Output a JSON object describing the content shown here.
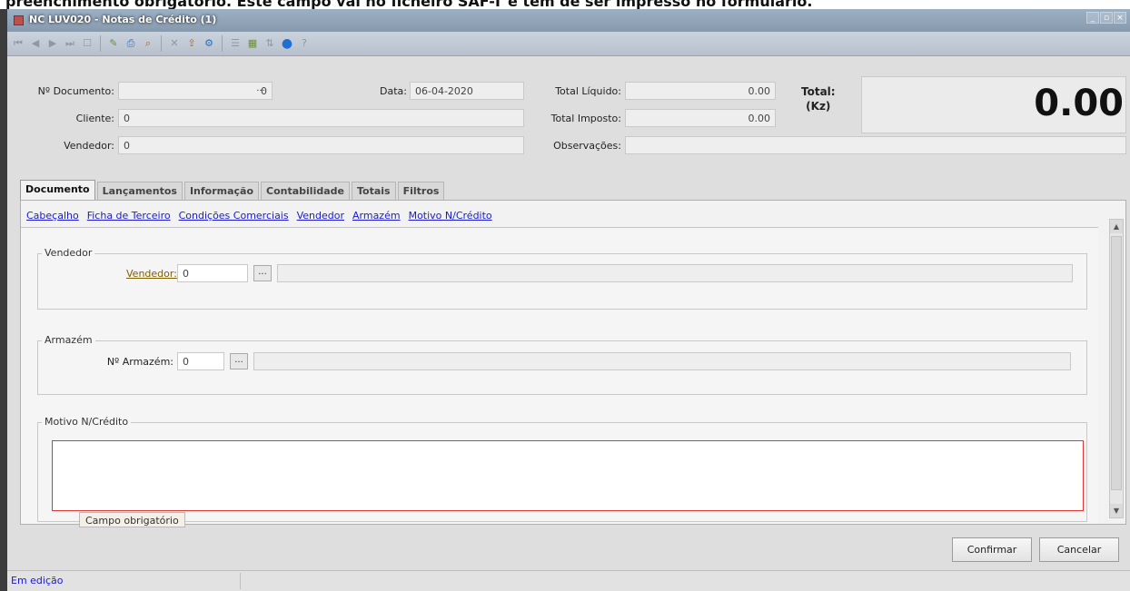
{
  "caption": "preenchimento obrigatório. Este campo vai no ficheiro SAF-T e tem de ser impresso no formulário.",
  "window": {
    "title": "NC LUV020 - Notas de Crédito (1)",
    "controls": [
      "_",
      "▫",
      "×"
    ]
  },
  "toolbar": {
    "icons": [
      "first-icon",
      "prev-icon",
      "next-icon",
      "last-icon",
      "new-icon",
      "edit-icon",
      "print-icon",
      "find-icon",
      "delete-icon",
      "export-icon",
      "tools-icon",
      "list-icon",
      "refresh-icon",
      "help-icon"
    ]
  },
  "header": {
    "documento_label": "Nº Documento:",
    "documento_value": "0",
    "documento_btn": "...",
    "data_label": "Data:",
    "data_value": "06-04-2020",
    "cliente_label": "Cliente:",
    "cliente_value": "0",
    "vendedor_label": "Vendedor:",
    "vendedor_value": "0",
    "total_liquido_label": "Total Líquido:",
    "total_liquido_value": "0.00",
    "total_imposto_label": "Total Imposto:",
    "total_imposto_value": "0.00",
    "observacoes_label": "Observações:",
    "observacoes_value": "",
    "total_label_line1": "Total:",
    "total_label_line2": "(Kz)",
    "total_value": "0.00"
  },
  "tabs": [
    {
      "label": "Documento",
      "active": true
    },
    {
      "label": "Lançamentos",
      "active": false
    },
    {
      "label": "Informação",
      "active": false
    },
    {
      "label": "Contabilidade",
      "active": false
    },
    {
      "label": "Totais",
      "active": false
    },
    {
      "label": "Filtros",
      "active": false
    }
  ],
  "section_links": [
    "Cabeçalho",
    "Ficha de Terceiro",
    "Condições Comerciais",
    "Vendedor",
    "Armazém",
    "Motivo N/Crédito"
  ],
  "vendedor_group": {
    "legend": "Vendedor",
    "label": "Vendedor:",
    "value": "0",
    "btn": "...",
    "description": ""
  },
  "armazem_group": {
    "legend": "Armazém",
    "label": "Nº Armazém:",
    "value": "0",
    "btn": "...",
    "description": ""
  },
  "motivo_group": {
    "legend": "Motivo N/Crédito",
    "value": "",
    "tooltip": "Campo obrigatório"
  },
  "buttons": {
    "confirmar": "Confirmar",
    "cancelar": "Cancelar"
  },
  "status": {
    "text": "Em edição"
  },
  "colors": {
    "link": "#1a1ad6",
    "required_border": "#e03535"
  }
}
